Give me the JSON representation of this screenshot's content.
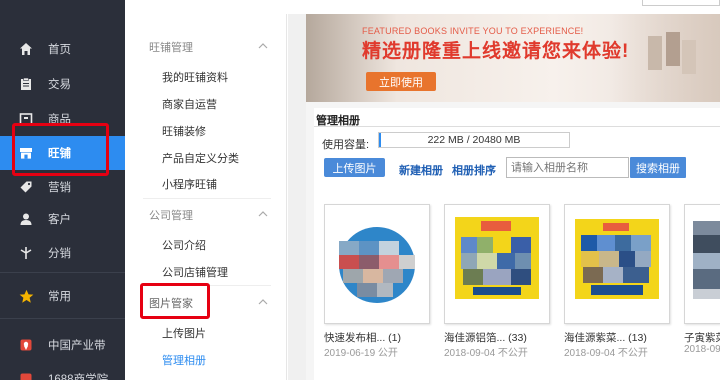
{
  "leftnav": {
    "items": [
      {
        "label": "首页",
        "icon": "home-icon"
      },
      {
        "label": "交易",
        "icon": "clipboard-icon"
      },
      {
        "label": "商品",
        "icon": "box-icon"
      },
      {
        "label": "旺铺",
        "icon": "store-icon",
        "active": true
      },
      {
        "label": "营销",
        "icon": "tag-icon"
      },
      {
        "label": "客户",
        "icon": "user-icon"
      },
      {
        "label": "分销",
        "icon": "distribution-icon"
      },
      {
        "label": "常用",
        "icon": "star-icon"
      },
      {
        "label": "中国产业带",
        "icon": "location-icon"
      },
      {
        "label": "1688商学院",
        "icon": "school-icon"
      }
    ]
  },
  "subnav": {
    "groups": [
      {
        "title": "旺铺管理",
        "items": [
          "我的旺铺资料",
          "商家自运营",
          "旺铺装修",
          "产品自定义分类",
          "小程序旺铺"
        ]
      },
      {
        "title": "公司管理",
        "items": [
          "公司介绍",
          "公司店铺管理"
        ]
      },
      {
        "title": "图片管家",
        "items": [
          "上传图片",
          "管理相册"
        ],
        "selected": "管理相册"
      }
    ]
  },
  "banner": {
    "subtitle": "FEATURED BOOKS INVITE YOU TO EXPERIENCE!",
    "title": "精选册隆重上线邀请您来体验!",
    "button": "立即使用"
  },
  "album": {
    "section_title": "管理相册",
    "capacity_label": "使用容量:",
    "capacity_value": "222 MB / 20480 MB",
    "capacity_fraction": 0.0108,
    "upload_button": "上传图片",
    "new_album_link": "新建相册",
    "sort_link": "相册排序",
    "search_placeholder": "请输入相册名称",
    "search_button": "搜索相册",
    "cards": [
      {
        "name": "快速发布相... (1)",
        "meta": "2019-06-19 公开"
      },
      {
        "name": "海佳源铝箔... (33)",
        "meta": "2018-09-04 不公开"
      },
      {
        "name": "海佳源紫菜... (13)",
        "meta": "2018-09-04 不公开"
      },
      {
        "name": "子寅紫菜",
        "meta": "2018-09"
      }
    ]
  },
  "colors": {
    "nav_bg": "#2b2f3a",
    "active_blue": "#2d8cf0",
    "highlight_red": "#e60012",
    "banner_red": "#e03a2d",
    "banner_button": "#e8742d"
  }
}
